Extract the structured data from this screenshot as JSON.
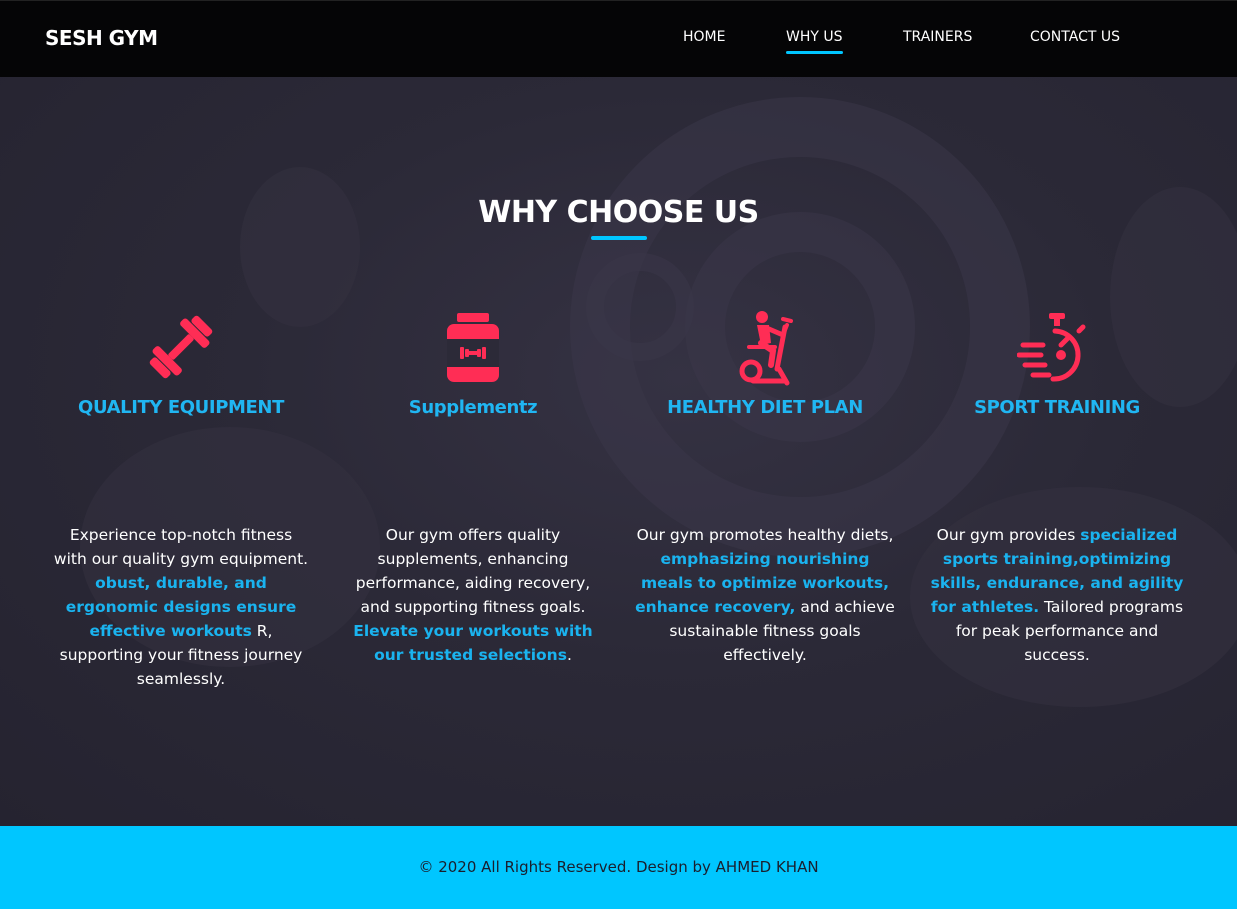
{
  "brand": "SESH GYM",
  "nav": [
    {
      "label": "HOME",
      "active": false
    },
    {
      "label": "WHY US",
      "active": true
    },
    {
      "label": "TRAINERS",
      "active": false
    },
    {
      "label": "CONTACT US",
      "active": false
    }
  ],
  "section_title": "WHY CHOOSE US",
  "colors": {
    "accent": "#00c6ff",
    "icon": "#ff2d55",
    "heading": "#20b6f2",
    "nav_bg": "#050506"
  },
  "features": [
    {
      "icon": "dumbbell-icon",
      "title": "QUALITY EQUIPMENT",
      "text_parts": [
        {
          "t": "Experience top-notch fitness with our quality gym equipment. ",
          "hl": false
        },
        {
          "t": "obust, durable, and ergonomic designs ensure effective workouts",
          "hl": true
        },
        {
          "t": " R, supporting your fitness journey seamlessly.",
          "hl": false
        }
      ]
    },
    {
      "icon": "supplement-jar-icon",
      "title": "Supplementz",
      "text_parts": [
        {
          "t": "Our gym offers quality supplements, enhancing performance, aiding recovery, and supporting fitness goals. ",
          "hl": false
        },
        {
          "t": "Elevate your workouts with our trusted selections",
          "hl": true
        },
        {
          "t": ".",
          "hl": false
        }
      ]
    },
    {
      "icon": "exercise-bike-icon",
      "title": "HEALTHY DIET PLAN",
      "text_parts": [
        {
          "t": "Our gym promotes healthy diets, ",
          "hl": false
        },
        {
          "t": "emphasizing nourishing meals to optimize workouts, enhance recovery,",
          "hl": true
        },
        {
          "t": " and achieve sustainable fitness goals effectively.",
          "hl": false
        }
      ]
    },
    {
      "icon": "stopwatch-icon",
      "title": "SPORT TRAINING",
      "text_parts": [
        {
          "t": "Our gym provides ",
          "hl": false
        },
        {
          "t": "specialized sports training,optimizing skills, endurance, and agility for athletes.",
          "hl": true
        },
        {
          "t": " Tailored programs for peak performance and success.",
          "hl": false
        }
      ]
    }
  ],
  "footer": "© 2020 All Rights Reserved. Design by AHMED KHAN"
}
